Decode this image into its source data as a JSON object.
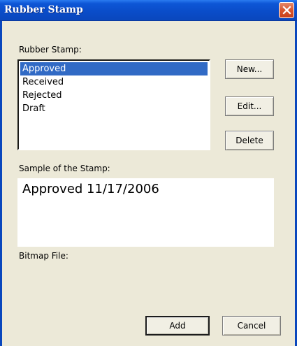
{
  "window": {
    "title": "Rubber Stamp",
    "close_icon": "close-icon"
  },
  "stamps": {
    "label": "Rubber Stamp:",
    "items": [
      {
        "label": "Approved",
        "selected": true
      },
      {
        "label": "Received",
        "selected": false
      },
      {
        "label": "Rejected",
        "selected": false
      },
      {
        "label": "Draft",
        "selected": false
      }
    ]
  },
  "buttons": {
    "new": "New...",
    "edit": "Edit...",
    "delete": "Delete",
    "add": "Add",
    "cancel": "Cancel"
  },
  "sample": {
    "label": "Sample of the Stamp:",
    "text": "Approved 11/17/2006"
  },
  "bitmap": {
    "label": "Bitmap File:"
  },
  "colors": {
    "titlebar": "#0a4cc8",
    "selection": "#316ac5",
    "close": "#d8552e",
    "dialog_bg": "#ece9d8"
  }
}
